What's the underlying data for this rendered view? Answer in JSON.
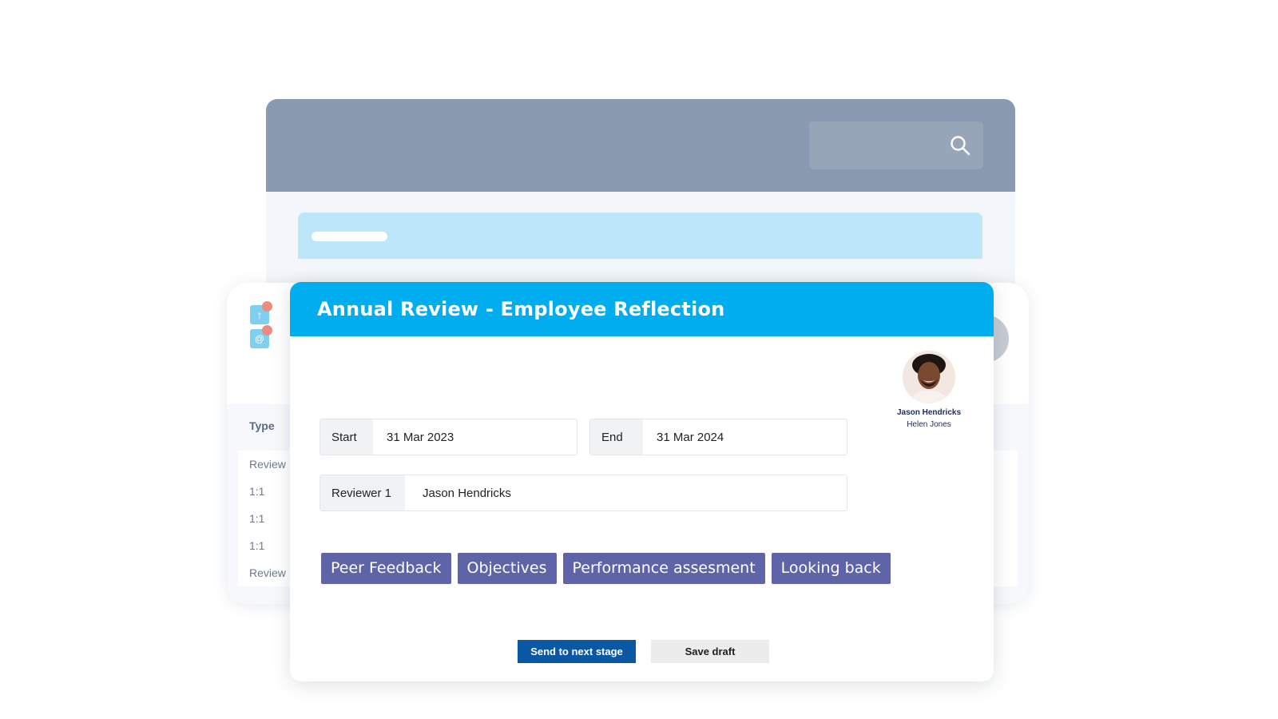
{
  "modal": {
    "title": "Annual Review - Employee Reflection",
    "person": {
      "name": "Jason Hendricks",
      "subtitle": "Helen Jones"
    },
    "fields": {
      "start_label": "Start",
      "start_value": "31 Mar 2023",
      "end_label": "End",
      "end_value": "31 Mar 2024",
      "reviewer_label": "Reviewer 1",
      "reviewer_value": "Jason Hendricks"
    },
    "tabs": [
      "Peer Feedback",
      "Objectives",
      "Performance assesment",
      "Looking back"
    ],
    "buttons": {
      "primary": "Send to next stage",
      "secondary": "Save draft"
    }
  },
  "side_panel": {
    "type_header": "Type",
    "rows": [
      "Review",
      "1:1",
      "1:1",
      "1:1",
      "Review"
    ],
    "icons": [
      "upload-icon",
      "mention-icon"
    ]
  },
  "colors": {
    "header_blue": "#00aeef",
    "tab_purple": "#5f64a8",
    "primary_button": "#0a57a4",
    "back_header": "#8a9ab0",
    "notification_dot": "#ef8a80"
  }
}
